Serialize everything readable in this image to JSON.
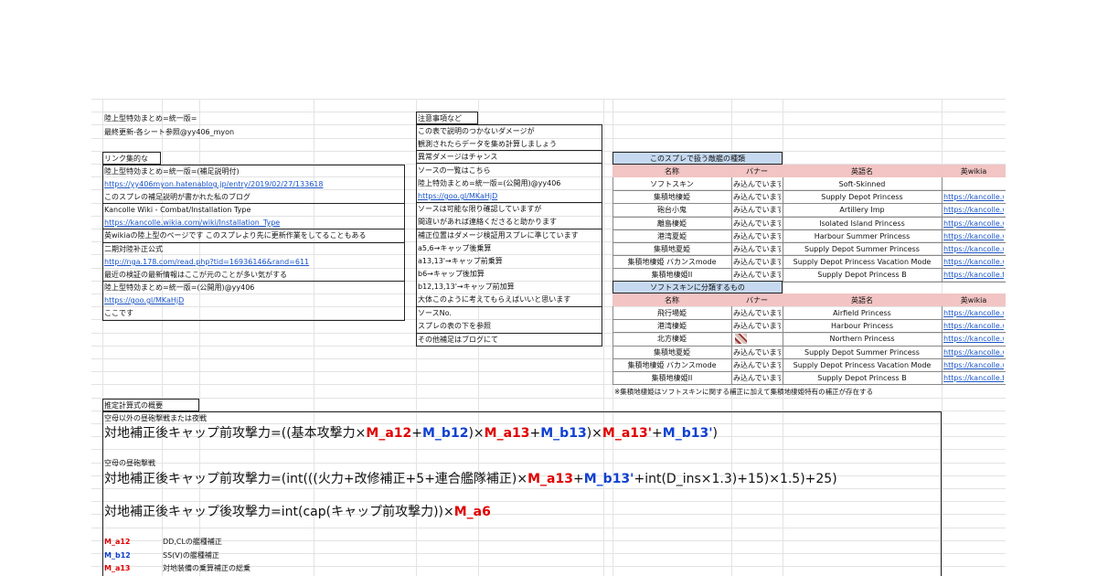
{
  "left_block": {
    "title": "陸上型特効まとめ=統一版=",
    "updated": "最終更新-各シート参照@yy406_myon",
    "links_header": "リンク集的な",
    "rows": [
      {
        "text": "陸上型特効まとめ=統一版=(補足説明付)",
        "link": false
      },
      {
        "text": "https://yy406myon.hatenablog.jp/entry/2019/02/27/133618",
        "link": true
      },
      {
        "text": "このスプレの補足説明が書かれた私のブログ",
        "link": false
      },
      {
        "text": "Kancolle Wiki - Combat/Installation Type",
        "link": false
      },
      {
        "text": "https://kancolle.wikia.com/wiki/Installation_Type",
        "link": true
      },
      {
        "text": "英wikiaの陸上型のページです このスプレより先に更新作業をしてることもある",
        "link": false
      },
      {
        "text": "二期対陸补正公式",
        "link": false
      },
      {
        "text": "http://nga.178.com/read.php?tid=16936146&rand=611",
        "link": true
      },
      {
        "text": "最近の検証の最新情報はここが元のことが多い気がする",
        "link": false
      },
      {
        "text": "陸上型特効まとめ=統一版=(公開用)@yy406",
        "link": false
      },
      {
        "text": "https://goo.gl/MKaHjD",
        "link": true
      },
      {
        "text": "ここです",
        "link": false
      }
    ]
  },
  "notes_block": {
    "header": "注意事項など",
    "rows": [
      {
        "text": "この表で説明のつかないダメージが",
        "link": false
      },
      {
        "text": "観測されたらデータを集め計算しましょう",
        "link": false
      },
      {
        "text": "異常ダメージはチャンス",
        "link": false
      },
      {
        "text": "ソースの一覧はこちら",
        "link": false
      },
      {
        "text": "陸上特効まとめ=統一版=(公開用)@yy406",
        "link": false
      },
      {
        "text": "https://goo.gl/MKaHjD",
        "link": true
      },
      {
        "text": "ソースは可能な限り確認していますが",
        "link": false
      },
      {
        "text": "間違いがあれば連絡くださると助かります",
        "link": false
      },
      {
        "text": "補正位置はダメージ検証用スプレに準じています",
        "link": false
      },
      {
        "text": "a5,6→キャップ後乗算",
        "link": false
      },
      {
        "text": "a13,13'→キャップ前乗算",
        "link": false
      },
      {
        "text": "b6→キャップ後加算",
        "link": false
      },
      {
        "text": "b12,13,13'→キャップ前加算",
        "link": false
      },
      {
        "text": "大体このように考えてもらえばいいと思います",
        "link": false
      },
      {
        "text": "ソースNo.",
        "link": false
      },
      {
        "text": "スプレの表の下を参照",
        "link": false
      },
      {
        "text": "その他補足はブログにて",
        "link": false
      }
    ]
  },
  "enemy_table": {
    "title": "このスプレで扱う敵艦の種類",
    "columns": [
      "名称",
      "バナー",
      "英語名",
      "英wikia"
    ],
    "rows": [
      {
        "name": "ソフトスキン",
        "banner": "み込んでいます",
        "en": "Soft-Skinned",
        "wikia": ""
      },
      {
        "name": "集積地棲姫",
        "banner": "み込んでいます",
        "en": "Supply Depot Princess",
        "wikia": "https://kancolle.w"
      },
      {
        "name": "砲台小鬼",
        "banner": "み込んでいます",
        "en": "Artillery Imp",
        "wikia": "https://kancolle.w"
      },
      {
        "name": "離島棲姫",
        "banner": "み込んでいます",
        "en": "Isolated Island Princess",
        "wikia": "https://kancolle.w"
      },
      {
        "name": "港湾夏姫",
        "banner": "み込んでいます",
        "en": "Harbour Summer Princess",
        "wikia": "https://kancolle.w"
      },
      {
        "name": "集積地夏姫",
        "banner": "み込んでいます",
        "en": "Supply Depot Summer Princess",
        "wikia": "https://kancolle.w"
      },
      {
        "name": "集積地棲姫 バカンスmode",
        "banner": "み込んでいます",
        "en": "Supply Depot Princess Vacation Mode",
        "wikia": "https://kancolle.w"
      },
      {
        "name": "集積地棲姫II",
        "banner": "み込んでいます",
        "en": "Supply Depot Princess B",
        "wikia": "https://kancolle.fa"
      }
    ],
    "sub_title": "ソフトスキンに分類するもの",
    "sub_rows": [
      {
        "name": "飛行場姫",
        "banner": "み込んでいます",
        "en": "Airfield Princess",
        "wikia": "https://kancolle.w"
      },
      {
        "name": "港湾棲姫",
        "banner": "み込んでいます",
        "en": "Harbour Princess",
        "wikia": "https://kancolle.w"
      },
      {
        "name": "北方棲姫",
        "banner": "",
        "en": "Northern Princess",
        "wikia": "https://kancolle.w"
      },
      {
        "name": "集積地夏姫",
        "banner": "み込んでいます",
        "en": "Supply Depot Summer Princess",
        "wikia": "https://kancolle.w"
      },
      {
        "name": "集積地棲姫 バカンスmode",
        "banner": "み込んでいます",
        "en": "Supply Depot Princess Vacation Mode",
        "wikia": "https://kancolle.w"
      },
      {
        "name": "集積地棲姫II",
        "banner": "み込んでいます",
        "en": "Supply Depot Princess B",
        "wikia": "https://kancolle.fa"
      }
    ],
    "footnote": "※集積地棲姫はソフトスキンに関する補正に加えて集積地棲姫特有の補正が存在する"
  },
  "formula": {
    "header": "推定計算式の概要",
    "section1": "空母以外の昼砲撃戦または夜戦",
    "f1": {
      "p1": "対地補正後キャップ前攻撃力=((基本攻撃力×",
      "a12": "M_a12",
      "plus1": "+",
      "b12": "M_b12",
      "p2": ")×",
      "a13": "M_a13",
      "plus2": "+",
      "b13": "M_b13",
      "p3": ")×",
      "a13p": "M_a13'",
      "plus3": "+",
      "b13p": "M_b13'",
      "p4": ")"
    },
    "section2": "空母の昼砲撃戦",
    "f2": {
      "p1": "対地補正後キャップ前攻撃力=(int(((火力+改修補正+5+連合艦隊補正)×",
      "a13": "M_a13",
      "plus": "+",
      "b13p": "M_b13'",
      "p2": "+int(D_ins×1.3)+15)×1.5)+25)"
    },
    "f3": {
      "p1": "対地補正後キャップ後攻撃力=int(cap(キャップ前攻撃力))×",
      "a6": "M_a6"
    },
    "legend": [
      {
        "key": "M_a12",
        "color": "red",
        "desc": "DD,CLの艦種補正"
      },
      {
        "key": "M_b12",
        "color": "blue",
        "desc": "SS(V)の艦種補正"
      },
      {
        "key": "M_a13",
        "color": "red",
        "desc": "対地装備の乗算補正の総乗"
      }
    ]
  }
}
